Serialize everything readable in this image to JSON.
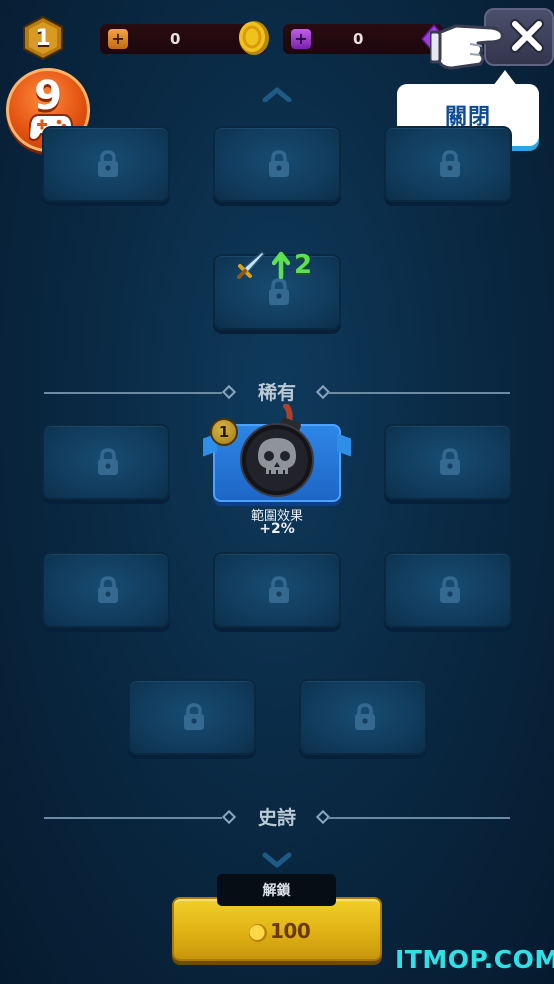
{
  "player": {
    "level": "1"
  },
  "currency": {
    "gold": {
      "value": "0",
      "icon": "gold-coin-icon"
    },
    "gem": {
      "value": "0",
      "icon": "purple-gem-icon"
    }
  },
  "close": {
    "tooltip": "關閉"
  },
  "games_badge": {
    "count": "9",
    "icon": "gamepad-icon"
  },
  "stat": {
    "value": "2",
    "icon": "sword-icon"
  },
  "sections": {
    "rare": "稀有",
    "epic": "史詩"
  },
  "item": {
    "level": "1",
    "name": "範圍效果",
    "bonus": "+2%",
    "icon": "skull-bomb-icon"
  },
  "unlock": {
    "label": "解鎖",
    "price": "100"
  },
  "watermark": "ITMOP.COM",
  "colors": {
    "accent_gold": "#e0b214",
    "accent_blue": "#2d86e6",
    "stat_green": "#5ee052",
    "watermark": "#2fe0e6"
  }
}
